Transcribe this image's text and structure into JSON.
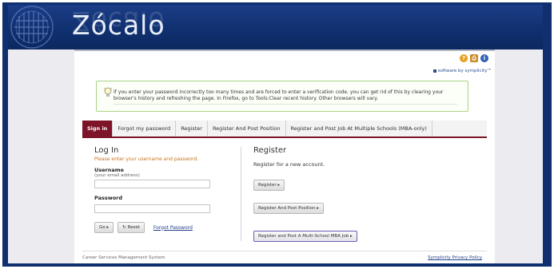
{
  "brand": {
    "name": "Zócalo"
  },
  "top_icons": {
    "help": "?",
    "print": "⎙",
    "info": "i"
  },
  "powered_by": "software by symplicity™",
  "notice": {
    "text": "If you enter your password incorrectly too many times and are forced to enter a verification code, you can get rid of this by clearing your browser's history and refreshing the page. In Firefox, go to Tools:Clear recent history. Other browsers will vary."
  },
  "tabs": [
    {
      "label": "Sign in",
      "active": true
    },
    {
      "label": "Forgot my password"
    },
    {
      "label": "Register"
    },
    {
      "label": "Register And Post Position"
    },
    {
      "label": "Register and Post Job At Multiple Schools (MBA-only)"
    }
  ],
  "login": {
    "title": "Log In",
    "hint": "Please enter your username and password.",
    "username_label": "Username",
    "username_sub": "(your email address)",
    "username_value": "",
    "password_label": "Password",
    "password_value": "",
    "go_label": "Go ▸",
    "reset_label": "↻ Reset",
    "forgot_label": "Forgot Password"
  },
  "register": {
    "title": "Register",
    "desc": "Register for a new account.",
    "btn_register": "Register ▸",
    "btn_post": "Register And Post Position ▸",
    "btn_multi": "Register and Post A Multi-School MBA Job ▸"
  },
  "footer": {
    "left": "Career Services Management System",
    "right": "Symplicity Privacy Policy"
  },
  "colors": {
    "header": "#0f2f6e",
    "tab_active": "#7d1428",
    "notice_border": "#a9d48a"
  }
}
